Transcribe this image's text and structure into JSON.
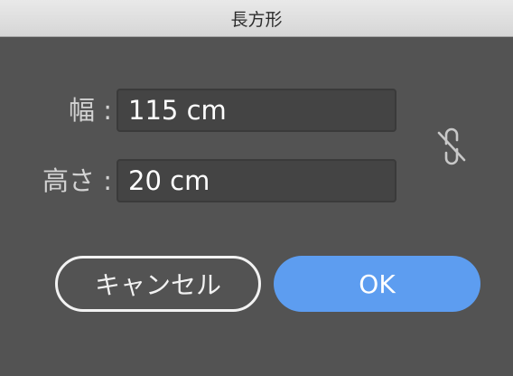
{
  "window": {
    "title": "長方形"
  },
  "fields": {
    "width_label": "幅 :",
    "width_value": "115 cm",
    "height_label": "高さ :",
    "height_value": "20 cm"
  },
  "icons": {
    "constrain_proportions": "unlinked-chain-icon"
  },
  "buttons": {
    "cancel_label": "キャンセル",
    "ok_label": "OK"
  },
  "colors": {
    "background": "#535353",
    "field_background": "#444444",
    "accent": "#5d9df0"
  }
}
